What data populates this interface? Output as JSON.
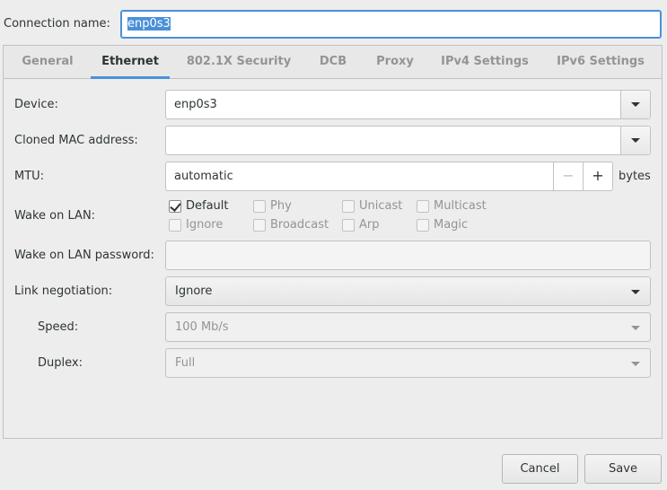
{
  "connection": {
    "label": "Connection name:",
    "value": "enp0s3"
  },
  "tabs": [
    {
      "label": "General",
      "active": false
    },
    {
      "label": "Ethernet",
      "active": true
    },
    {
      "label": "802.1X Security",
      "active": false
    },
    {
      "label": "DCB",
      "active": false
    },
    {
      "label": "Proxy",
      "active": false
    },
    {
      "label": "IPv4 Settings",
      "active": false
    },
    {
      "label": "IPv6 Settings",
      "active": false
    }
  ],
  "ethernet": {
    "device_label": "Device:",
    "device_value": "enp0s3",
    "cloned_mac_label": "Cloned MAC address:",
    "cloned_mac_value": "",
    "mtu_label": "MTU:",
    "mtu_value": "automatic",
    "mtu_unit": "bytes",
    "wol_label": "Wake on LAN:",
    "wol_options": [
      {
        "label": "Default",
        "checked": true,
        "enabled": true
      },
      {
        "label": "Phy",
        "checked": false,
        "enabled": false
      },
      {
        "label": "Unicast",
        "checked": false,
        "enabled": false
      },
      {
        "label": "Multicast",
        "checked": false,
        "enabled": false
      },
      {
        "label": "Ignore",
        "checked": false,
        "enabled": false
      },
      {
        "label": "Broadcast",
        "checked": false,
        "enabled": false
      },
      {
        "label": "Arp",
        "checked": false,
        "enabled": false
      },
      {
        "label": "Magic",
        "checked": false,
        "enabled": false
      }
    ],
    "wol_password_label": "Wake on LAN password:",
    "wol_password_value": "",
    "link_negotiation_label": "Link negotiation:",
    "link_negotiation_value": "Ignore",
    "speed_label": "Speed:",
    "speed_value": "100 Mb/s",
    "duplex_label": "Duplex:",
    "duplex_value": "Full"
  },
  "buttons": {
    "cancel": "Cancel",
    "save": "Save"
  },
  "colors": {
    "accent": "#4a90d9",
    "disabled_text": "#929595"
  }
}
